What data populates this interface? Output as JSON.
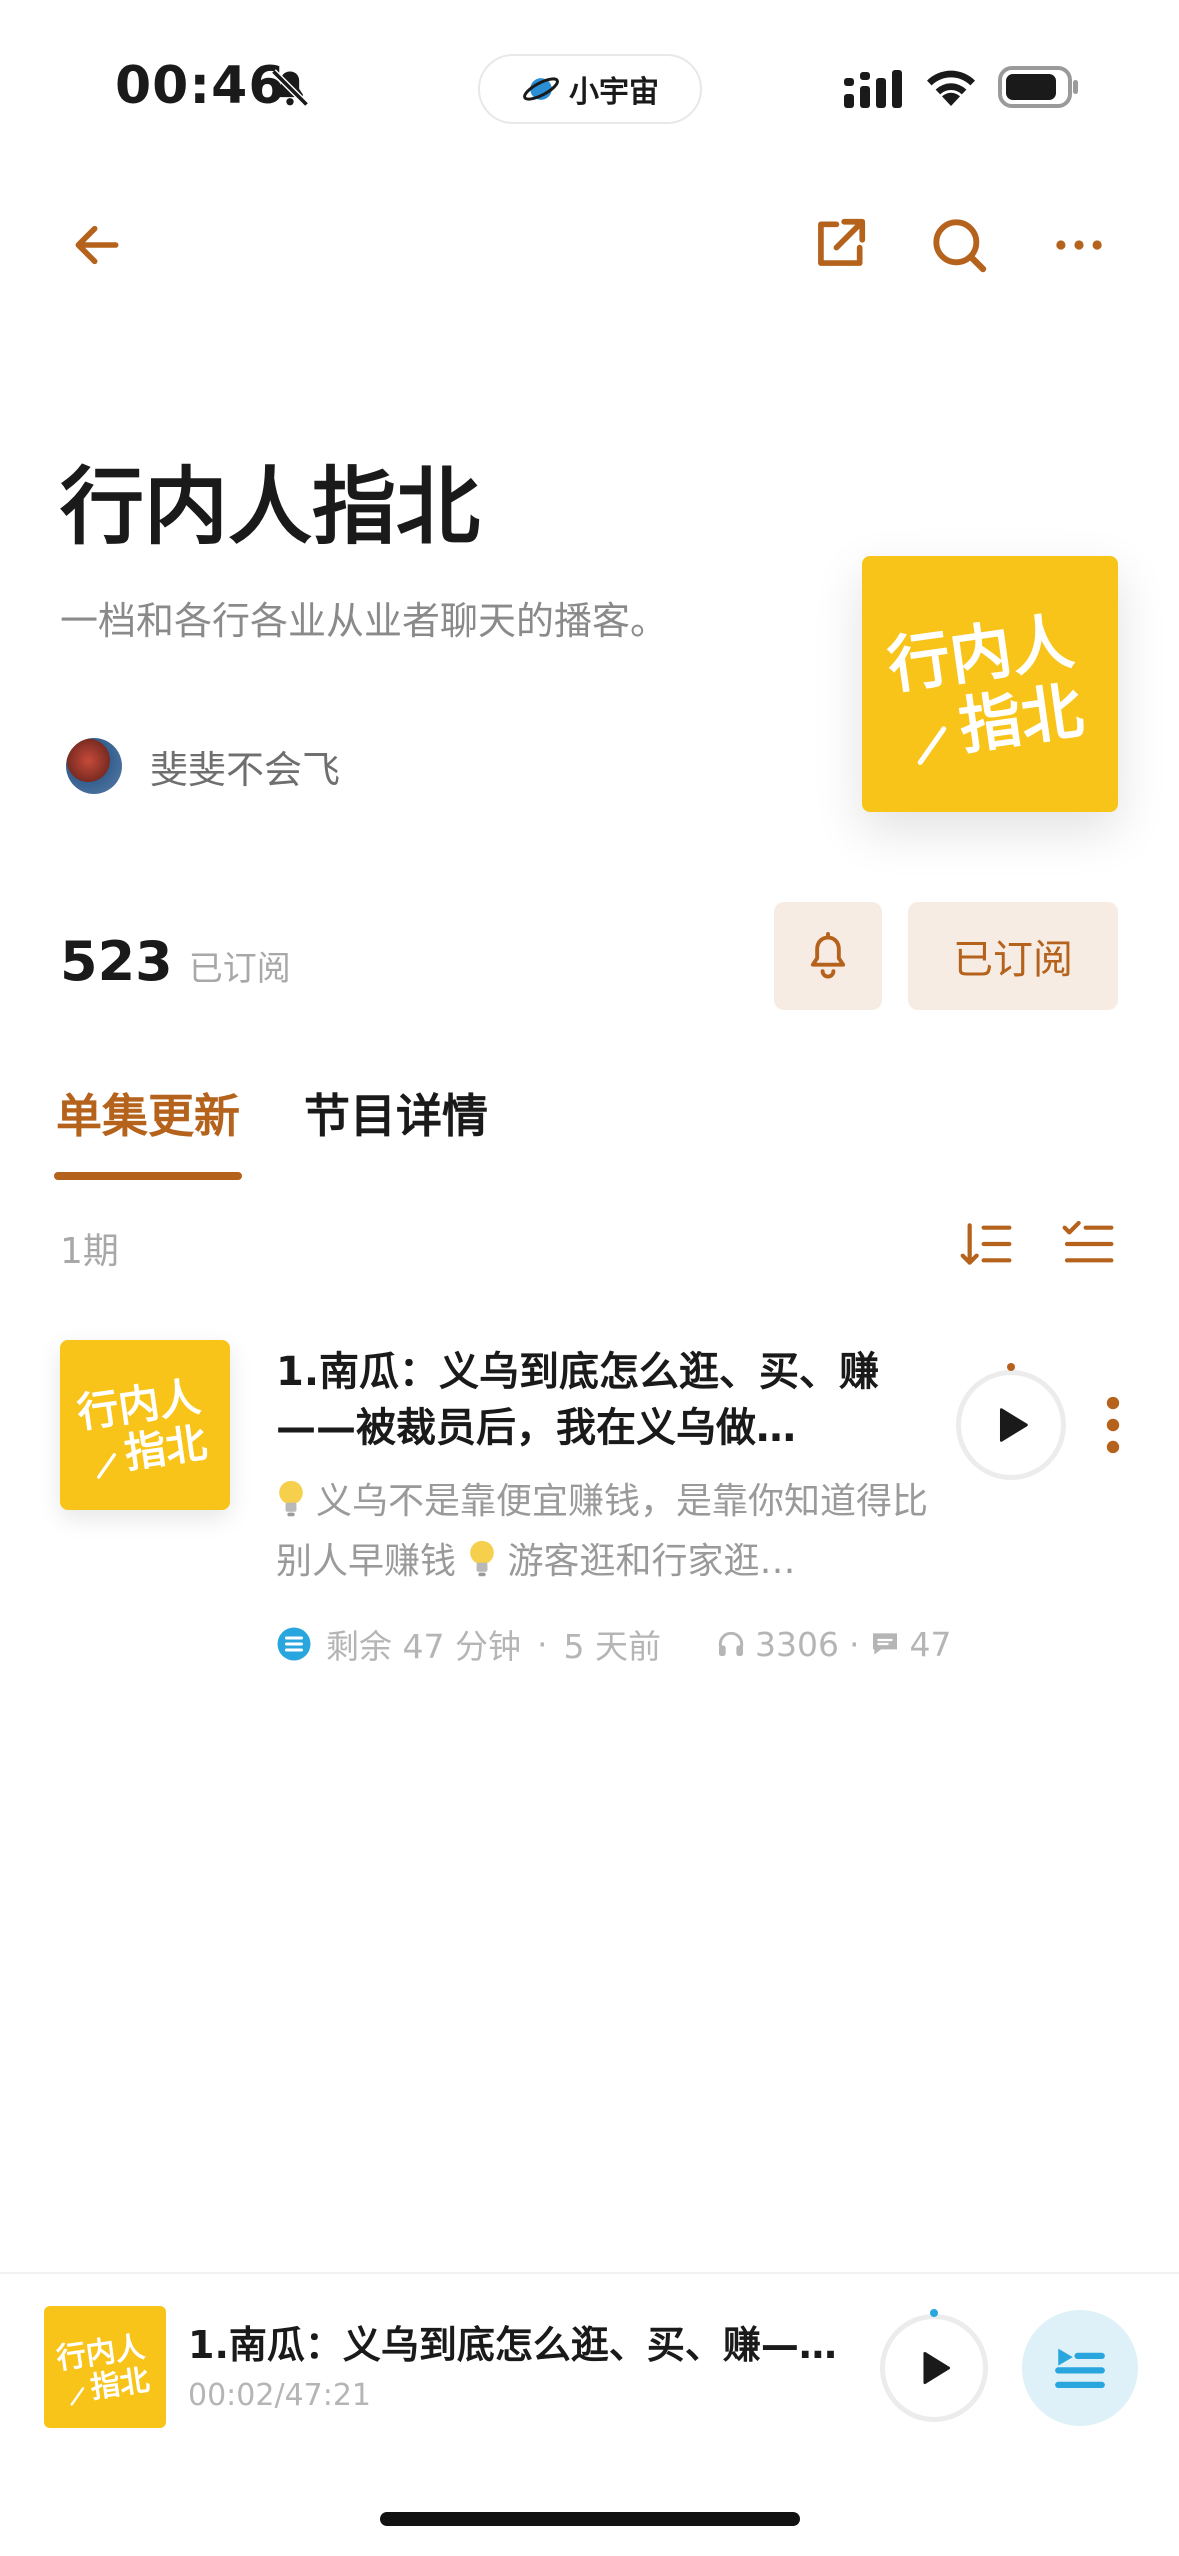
{
  "status_bar": {
    "time": "00:46",
    "island_label": "小宇宙",
    "icons": [
      "bell-off-icon",
      "cellular-signal-icon",
      "wifi-icon",
      "battery-icon"
    ]
  },
  "nav": {
    "icons": [
      "back-arrow-icon",
      "share-icon",
      "search-icon",
      "more-icon"
    ]
  },
  "podcast": {
    "title": "行内人指北",
    "description": "一档和各行各业从业者聊天的播客。",
    "author": "斐斐不会飞",
    "cover_text_line1": "行内人",
    "cover_text_line2": "指北",
    "subscriber_count": "523",
    "subscriber_label": "已订阅",
    "subscribed_button": "已订阅"
  },
  "tabs": [
    {
      "label": "单集更新",
      "active": true
    },
    {
      "label": "节目详情",
      "active": false
    }
  ],
  "episode_list": {
    "count_label": "1期",
    "episodes": [
      {
        "title": "1.南瓜：义乌到底怎么逛、买、赚——被裁员后，我在义乌做…",
        "desc_part1": "义乌不是靠便宜赚钱，是靠你知道得比别人早赚钱",
        "desc_part2": "游客逛和行家逛…",
        "remaining": "剩余 47 分钟",
        "posted": "5 天前",
        "plays": "3306",
        "comments": "47"
      }
    ]
  },
  "mini_player": {
    "title": "1.南瓜：义乌到底怎么逛、买、赚—…",
    "progress": "00:02/47:21"
  },
  "colors": {
    "accent": "#b5621c",
    "cover_yellow": "#f8c41a",
    "muted": "#a8a8a8",
    "blue": "#2aa6df"
  }
}
